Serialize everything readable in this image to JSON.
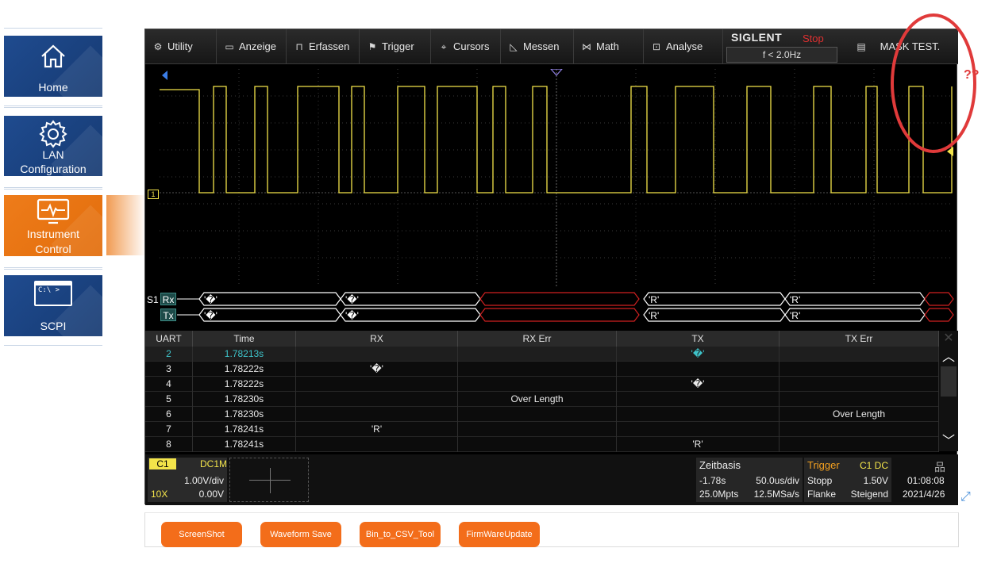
{
  "nav": {
    "items": [
      {
        "label": "Home",
        "icon": "home-icon"
      },
      {
        "label_1": "LAN",
        "label_2": "Configuration",
        "icon": "gear-icon"
      },
      {
        "label_1": "Instrument",
        "label_2": "Control",
        "icon": "monitor-pulse-icon"
      },
      {
        "label": "SCPI",
        "icon": "terminal-icon",
        "terminal_text": "C:\\ >"
      }
    ]
  },
  "scope": {
    "menu": [
      "Utility",
      "Anzeige",
      "Erfassen",
      "Trigger",
      "Cursors",
      "Messen",
      "Math",
      "Analyse"
    ],
    "brand": "SIGLENT",
    "run_state": "Stop",
    "freq": "f < 2.0Hz",
    "mask_test": "MASK TEST.",
    "decode": {
      "bus": "S1",
      "rx_label": "Rx",
      "tx_label": "Tx",
      "rx_frames": [
        "'�'",
        "'�'",
        "'R'",
        "'R'"
      ],
      "tx_frames": [
        "'�'",
        "'�'",
        "'R'",
        "'R'"
      ]
    },
    "table": {
      "headers": [
        "UART",
        "Time",
        "RX",
        "RX Err",
        "TX",
        "TX Err"
      ],
      "rows": [
        [
          "2",
          "1.78213s",
          "",
          "",
          "'�'",
          ""
        ],
        [
          "3",
          "1.78222s",
          "'�'",
          "",
          "",
          ""
        ],
        [
          "4",
          "1.78222s",
          "",
          "",
          "'�'",
          ""
        ],
        [
          "5",
          "1.78230s",
          "",
          "Over Length",
          "",
          ""
        ],
        [
          "6",
          "1.78230s",
          "",
          "",
          "",
          "Over Length"
        ],
        [
          "7",
          "1.78241s",
          "'R'",
          "",
          "",
          ""
        ],
        [
          "8",
          "1.78241s",
          "",
          "",
          "'R'",
          ""
        ]
      ]
    },
    "channel": {
      "name": "C1",
      "coupling": "DC1M",
      "vdiv": "1.00V/div",
      "probe": "10X",
      "offset": "0.00V"
    },
    "timebase": {
      "title": "Zeitbasis",
      "delay": "-1.78s",
      "tdiv": "50.0us/div",
      "points": "25.0Mpts",
      "rate": "12.5MSa/s"
    },
    "trigger": {
      "title": "Trigger",
      "source": "C1 DC",
      "state": "Stopp",
      "level": "1.50V",
      "type": "Flanke",
      "slope": "Steigend"
    },
    "clock": {
      "time": "01:08:08",
      "date": "2021/4/26"
    }
  },
  "annotation": {
    "text": "??",
    "color": "#e03a3a"
  },
  "buttons": [
    "ScreenShot",
    "Waveform Save",
    "Bin_to_CSV_Tool",
    "FirmWareUpdate"
  ],
  "colors": {
    "nav_blue": "#1f4b8f",
    "nav_active": "#ee7c1a",
    "trace_yellow": "#f3e44a",
    "button_orange": "#f36d1a"
  }
}
